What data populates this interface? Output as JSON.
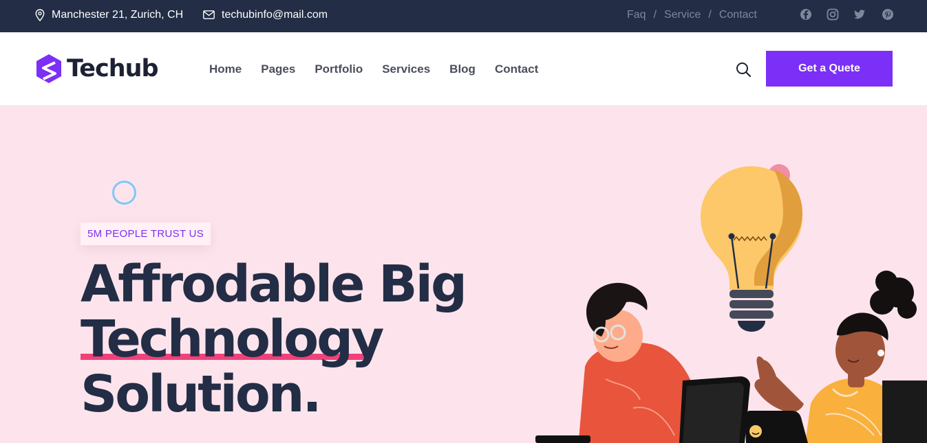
{
  "topbar": {
    "address": "Manchester 21, Zurich, CH",
    "email": "techubinfo@mail.com",
    "links": [
      "Faq",
      "Service",
      "Contact"
    ],
    "separator": "/",
    "social_icons": [
      "facebook-icon",
      "instagram-icon",
      "twitter-icon",
      "pinterest-icon"
    ]
  },
  "nav": {
    "logo_text": "Techub",
    "menu": [
      "Home",
      "Pages",
      "Portfolio",
      "Services",
      "Blog",
      "Contact"
    ],
    "cta_label": "Get a Quete"
  },
  "hero": {
    "badge": "5M PEOPLE TRUST US",
    "headline": [
      "Affrodable Big",
      "Technology",
      "Solution."
    ]
  },
  "colors": {
    "topbar_bg": "#232d45",
    "accent": "#7b2ff7",
    "hero_bg": "#fde4ec",
    "underline": "#f0417a"
  }
}
